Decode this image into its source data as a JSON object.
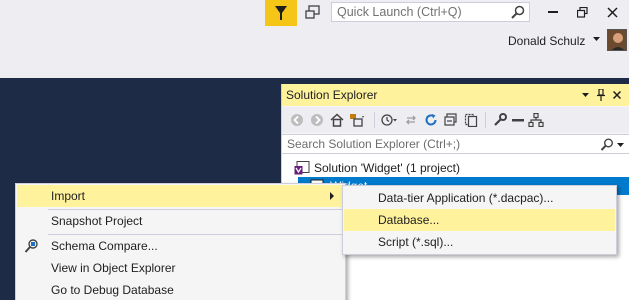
{
  "titlebar": {
    "quick_launch_placeholder": "Quick Launch (Ctrl+Q)",
    "notification_color": "#f5c518"
  },
  "account": {
    "user_name": "Donald Schulz"
  },
  "solution_explorer": {
    "title": "Solution Explorer",
    "search_placeholder": "Search Solution Explorer (Ctrl+;)",
    "tree": [
      {
        "label": "Solution 'Widget' (1 project)",
        "icon": "solution-icon"
      },
      {
        "label": "Widget",
        "icon": "database-project-icon",
        "selected": true
      }
    ],
    "selection_color": "#007acc"
  },
  "context_menu": {
    "items": [
      {
        "label": "Import",
        "has_submenu": true,
        "highlighted": true
      },
      {
        "label": "Snapshot Project"
      },
      {
        "label": "Schema Compare...",
        "icon": "schema-compare-icon"
      },
      {
        "label": "View in Object Explorer"
      },
      {
        "label": "Go to Debug Database"
      }
    ]
  },
  "import_submenu": {
    "items": [
      {
        "label": "Data-tier Application (*.dacpac)..."
      },
      {
        "label": "Database...",
        "highlighted": true
      },
      {
        "label": "Script (*.sql)..."
      }
    ]
  },
  "colors": {
    "background": "#1e2b47",
    "chrome": "#eeeef2",
    "highlight": "#fff29d"
  }
}
